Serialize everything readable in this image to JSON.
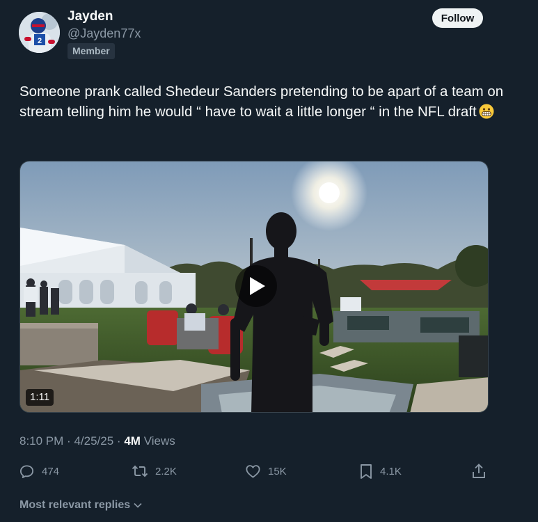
{
  "author": {
    "name": "Jayden",
    "handle": "@Jayden77x",
    "badge": "Member",
    "avatar_icon": "user-avatar"
  },
  "follow_label": "Follow",
  "tweet": {
    "text": "Someone prank called Shedeur Sanders pretending to be apart of a team on stream telling him he would “ have to wait a little longer “ in the NFL draft",
    "emoji_icon": "grimacing-face-emoji"
  },
  "video": {
    "duration": "1:11",
    "play_icon": "play-icon"
  },
  "meta": {
    "time": "8:10 PM",
    "date": "4/25/25",
    "separator": "·",
    "views_count": "4M",
    "views_label": "Views"
  },
  "actions": {
    "replies": "474",
    "reposts": "2.2K",
    "likes": "15K",
    "bookmarks": "4.1K"
  },
  "replies_sort_label": "Most relevant replies",
  "colors": {
    "background": "#15202b",
    "text": "#f7f9f9",
    "muted": "#8b98a5",
    "follow_bg": "#eff3f4"
  }
}
